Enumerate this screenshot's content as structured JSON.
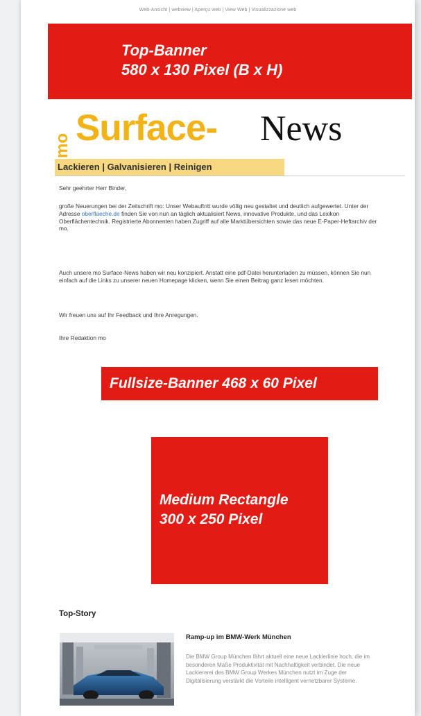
{
  "header": {
    "links_text": "Web-Ansicht | webview | Aperçu web | View Web | Visualizzazione web"
  },
  "top_banner": {
    "line1": "Top-Banner",
    "line2": "580 x 130 Pixel (B x H)"
  },
  "logo": {
    "prefix": "mo",
    "surface": "Surface-",
    "news": "News",
    "tagline": "Lackieren | Galvanisieren | Reinigen"
  },
  "letter": {
    "salutation": "Sehr geehrter Herr Binder,",
    "p1_before_link": "große Neuerungen bei der Zeitschrift mo: Unser Webauftritt wurde völlig neu gestaltet und deutlich aufgewertet. Unter der Adresse ",
    "p1_link": "oberflaeche.de",
    "p1_after_link": " finden Sie von nun an täglich aktualisiert News, innovative Produkte, und das Lexikon Oberflächentechnik. Registrierte Abonnenten haben Zugriff auf alle Marktübersichten sowie das neue E-Paper-Heftarchiv der mo.",
    "p2": "Auch unsere mo Surface-News haben wir neu konzipiert. Anstatt eine pdf-Datei herunterladen zu müssen, können Sie nun einfach auf die Links zu unserer neuen Homepage klicken, wenn Sie einen Beitrag ganz lesen möchten.",
    "p3": "Wir freuen uns auf Ihr Feedback und Ihre Anregungen.",
    "signoff": "Ihre Redaktion mo"
  },
  "fullsize_banner": {
    "label": "Fullsize-Banner 468 x 60 Pixel"
  },
  "medium_rectangle": {
    "line1": "Medium Rectangle",
    "line2": "300 x 250 Pixel"
  },
  "top_story": {
    "section_title": "Top-Story",
    "headline": "Ramp-up im BMW-Werk München",
    "teaser": "Die BMW Group München fährt aktuell eine neue Lackierlinie hoch, die im besonderen Maße Produktivität mit Nachhaltigkeit verbindet. Die neue Lackiererei des BMW Group Werkes München nutzt im Zuge der Digitalisierung verstärkt die Vorteile intelligent vernetzbarer Systeme."
  },
  "colors": {
    "banner_red": "#e21c14",
    "logo_yellow": "#f2b318",
    "tagline_bg": "#f7d780",
    "link_blue": "#2d72c7"
  }
}
